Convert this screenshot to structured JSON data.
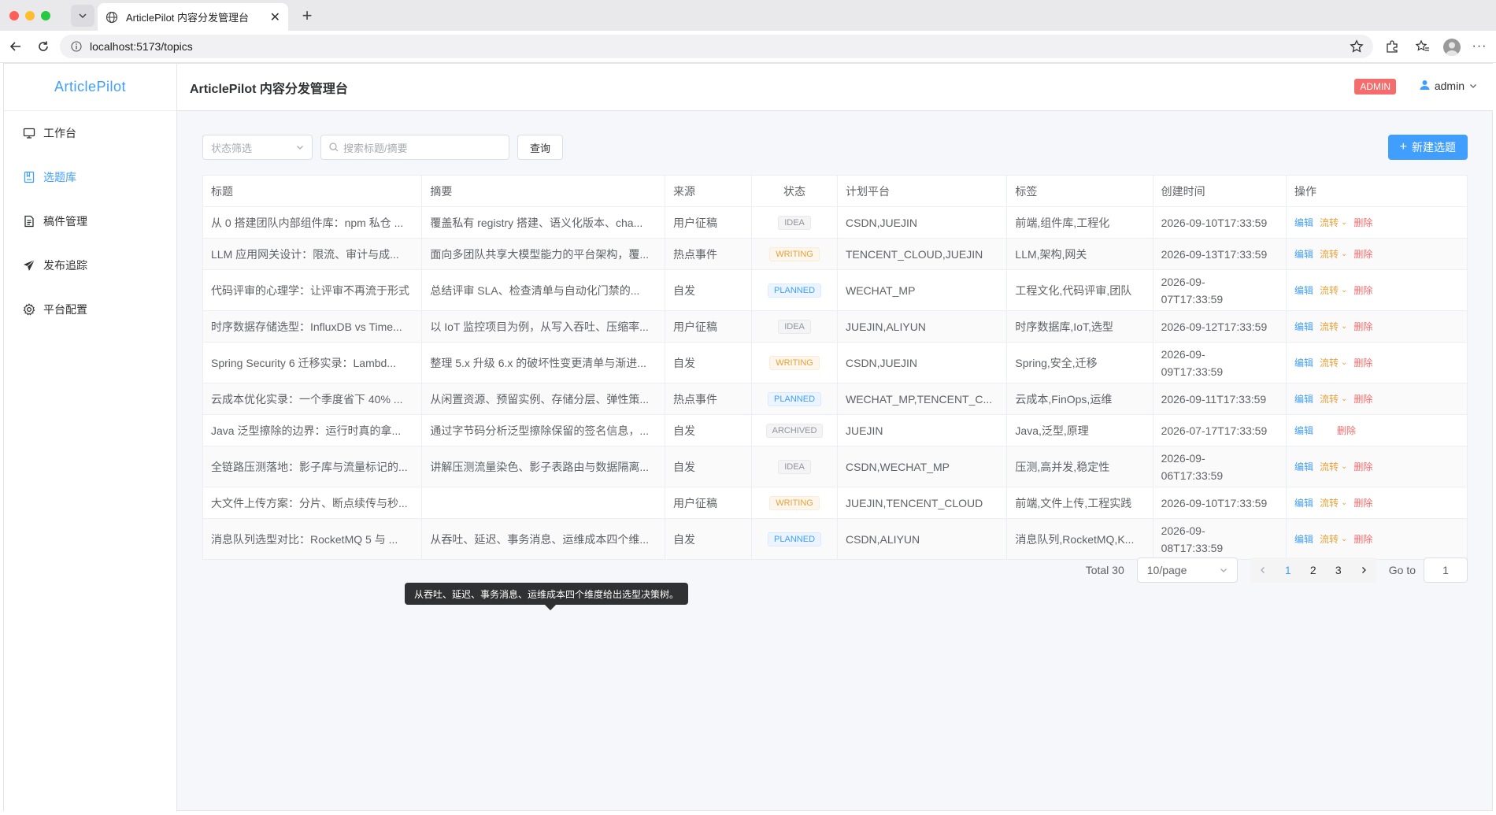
{
  "browser": {
    "tab_title": "ArticlePilot 内容分发管理台",
    "url": "localhost:5173/topics"
  },
  "app": {
    "brand": "ArticlePilot",
    "header_title": "ArticlePilot 内容分发管理台",
    "role_badge": "ADMIN",
    "username": "admin",
    "menu": [
      {
        "label": "工作台",
        "icon": "monitor-icon",
        "active": false
      },
      {
        "label": "选题库",
        "icon": "notebook-icon",
        "active": true
      },
      {
        "label": "稿件管理",
        "icon": "document-icon",
        "active": false
      },
      {
        "label": "发布追踪",
        "icon": "send-icon",
        "active": false
      },
      {
        "label": "平台配置",
        "icon": "gear-icon",
        "active": false
      }
    ]
  },
  "filters": {
    "status_placeholder": "状态筛选",
    "search_placeholder": "搜索标题/摘要",
    "query_label": "查询",
    "new_label": "新建选题"
  },
  "table": {
    "headers": [
      "标题",
      "摘要",
      "来源",
      "状态",
      "计划平台",
      "标签",
      "创建时间",
      "操作"
    ],
    "ops": {
      "edit": "编辑",
      "flow": "流转",
      "delete": "删除"
    },
    "rows": [
      {
        "title": "从 0 搭建团队内部组件库：npm 私仓 ...",
        "summary": "覆盖私有 registry 搭建、语义化版本、cha...",
        "source": "用户征稿",
        "status": "IDEA",
        "platforms": "CSDN,JUEJIN",
        "tags": "前端,组件库,工程化",
        "created": "2026-09-10T17:33:59",
        "created_l1": "",
        "created_l2": "",
        "flow": true
      },
      {
        "title": "LLM 应用网关设计：限流、审计与成...",
        "summary": "面向多团队共享大模型能力的平台架构，覆...",
        "source": "热点事件",
        "status": "WRITING",
        "platforms": "TENCENT_CLOUD,JUEJIN",
        "tags": "LLM,架构,网关",
        "created": "2026-09-13T17:33:59",
        "created_l1": "",
        "created_l2": "",
        "flow": true
      },
      {
        "title": "代码评审的心理学：让评审不再流于形式",
        "summary": "总结评审 SLA、检查清单与自动化门禁的...",
        "source": "自发",
        "status": "PLANNED",
        "platforms": "WECHAT_MP",
        "tags": "工程文化,代码评审,团队",
        "created": "",
        "created_l1": "2026-09-",
        "created_l2": "07T17:33:59",
        "flow": true
      },
      {
        "title": "时序数据存储选型：InfluxDB vs Time...",
        "summary": "以 IoT 监控项目为例，从写入吞吐、压缩率...",
        "source": "用户征稿",
        "status": "IDEA",
        "platforms": "JUEJIN,ALIYUN",
        "tags": "时序数据库,IoT,选型",
        "created": "2026-09-12T17:33:59",
        "created_l1": "",
        "created_l2": "",
        "flow": true
      },
      {
        "title": "Spring Security 6 迁移实录：Lambd...",
        "summary": "整理 5.x 升级 6.x 的破坏性变更清单与渐进...",
        "source": "自发",
        "status": "WRITING",
        "platforms": "CSDN,JUEJIN",
        "tags": "Spring,安全,迁移",
        "created": "",
        "created_l1": "2026-09-",
        "created_l2": "09T17:33:59",
        "flow": true
      },
      {
        "title": "云成本优化实录：一个季度省下 40% ...",
        "summary": "从闲置资源、预留实例、存储分层、弹性策...",
        "source": "热点事件",
        "status": "PLANNED",
        "platforms": "WECHAT_MP,TENCENT_C...",
        "tags": "云成本,FinOps,运维",
        "created": "2026-09-11T17:33:59",
        "created_l1": "",
        "created_l2": "",
        "flow": true
      },
      {
        "title": "Java 泛型擦除的边界：运行时真的拿...",
        "summary": "通过字节码分析泛型擦除保留的签名信息，...",
        "source": "自发",
        "status": "ARCHIVED",
        "platforms": "JUEJIN",
        "tags": "Java,泛型,原理",
        "created": "2026-07-17T17:33:59",
        "created_l1": "",
        "created_l2": "",
        "flow": false
      },
      {
        "title": "全链路压测落地：影子库与流量标记的...",
        "summary": "讲解压测流量染色、影子表路由与数据隔离...",
        "source": "自发",
        "status": "IDEA",
        "platforms": "CSDN,WECHAT_MP",
        "tags": "压测,高并发,稳定性",
        "created": "",
        "created_l1": "2026-09-",
        "created_l2": "06T17:33:59",
        "flow": true
      },
      {
        "title": "大文件上传方案：分片、断点续传与秒...",
        "summary": "",
        "source": "用户征稿",
        "status": "WRITING",
        "platforms": "JUEJIN,TENCENT_CLOUD",
        "tags": "前端,文件上传,工程实践",
        "created": "2026-09-10T17:33:59",
        "created_l1": "",
        "created_l2": "",
        "flow": true
      },
      {
        "title": "消息队列选型对比：RocketMQ 5 与 ...",
        "summary": "从吞吐、延迟、事务消息、运维成本四个维...",
        "source": "自发",
        "status": "PLANNED",
        "platforms": "CSDN,ALIYUN",
        "tags": "消息队列,RocketMQ,K...",
        "created": "",
        "created_l1": "2026-09-",
        "created_l2": "08T17:33:59",
        "flow": true
      }
    ]
  },
  "tooltip": "从吞吐、延迟、事务消息、运维成本四个维度给出选型决策树。",
  "pagination": {
    "total": "Total 30",
    "page_size": "10/page",
    "pages": [
      "1",
      "2",
      "3"
    ],
    "current": "1",
    "goto_label": "Go to",
    "goto_value": "1"
  }
}
